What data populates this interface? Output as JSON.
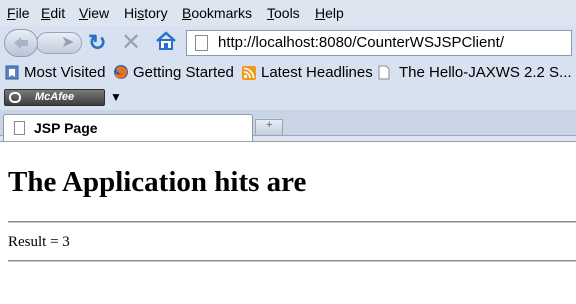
{
  "menu": {
    "items": [
      {
        "key": "F",
        "rest": "ile"
      },
      {
        "key": "E",
        "rest": "dit"
      },
      {
        "key": "V",
        "rest": "iew"
      },
      {
        "key": "",
        "rest": "History",
        "pre": "Hi",
        "mid": "s",
        "post": "tory"
      },
      {
        "key": "B",
        "rest": "ookmarks"
      },
      {
        "key": "T",
        "rest": "ools"
      },
      {
        "key": "H",
        "rest": "elp"
      }
    ]
  },
  "nav": {
    "url": "http://localhost:8080/CounterWSJSPClient/"
  },
  "bookmarks": {
    "items": [
      "Most Visited",
      "Getting Started",
      "Latest Headlines",
      "The Hello-JAXWS 2.2 S..."
    ]
  },
  "toolbar": {
    "mcafee_label": "McAfee"
  },
  "tabs": {
    "active_title": "JSP Page"
  },
  "page": {
    "heading": "The Application hits are",
    "result": "Result = 3"
  },
  "colors": {
    "chrome_bg": "#d8e1ef",
    "reload_blue": "#2a6fc9"
  }
}
